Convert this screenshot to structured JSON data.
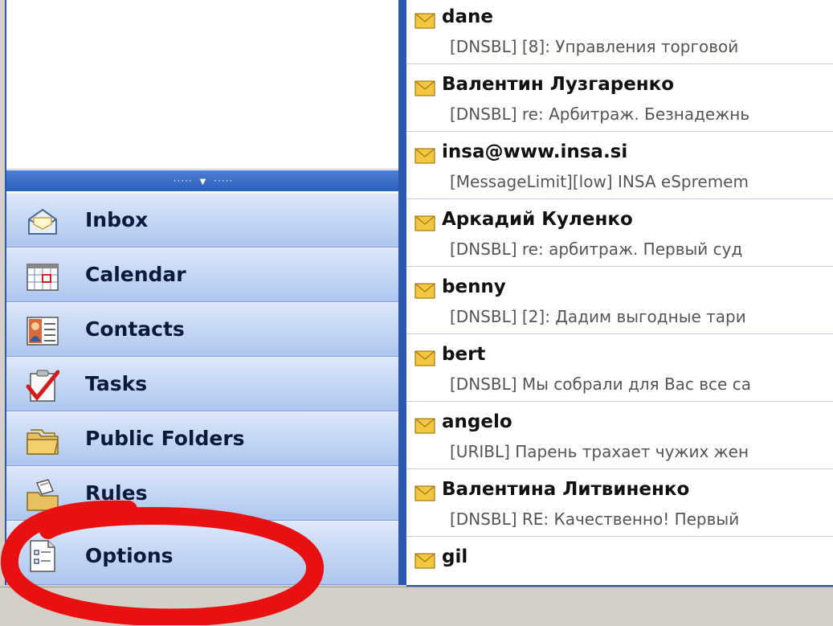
{
  "nav": {
    "splitter_dots_left": "·····",
    "splitter_dots_right": "·····",
    "buttons": [
      {
        "label": "Inbox",
        "icon": "inbox-icon"
      },
      {
        "label": "Calendar",
        "icon": "calendar-icon"
      },
      {
        "label": "Contacts",
        "icon": "contacts-icon"
      },
      {
        "label": "Tasks",
        "icon": "tasks-icon"
      },
      {
        "label": "Public Folders",
        "icon": "public-folders-icon"
      },
      {
        "label": "Rules",
        "icon": "rules-icon"
      },
      {
        "label": "Options",
        "icon": "options-icon"
      }
    ]
  },
  "messages": [
    {
      "from": "dane",
      "subject": "[DNSBL] [8]: Управления торговой"
    },
    {
      "from": "Валентин Лузгаренко",
      "subject": "[DNSBL] re: Арбитраж. Безнадежнь"
    },
    {
      "from": "insa@www.insa.si",
      "subject": "[MessageLimit][low] INSA eSpremem"
    },
    {
      "from": "Аркадий Куленко",
      "subject": "[DNSBL] re: арбитраж. Первый суд"
    },
    {
      "from": "benny",
      "subject": "[DNSBL] [2]: Дадим выгодные тари"
    },
    {
      "from": "bert",
      "subject": "[DNSBL] Мы собрали для Вас все са"
    },
    {
      "from": "angelo",
      "subject": "[URIBL] Парень трахает чужих жен"
    },
    {
      "from": "Валентина Литвиненко",
      "subject": "[DNSBL] RE: Качественно! Первый"
    },
    {
      "from": "gil",
      "subject": ""
    }
  ],
  "colors": {
    "accent": "#2c58b0",
    "annotation": "#e81010",
    "envelope": "#f2c640"
  }
}
